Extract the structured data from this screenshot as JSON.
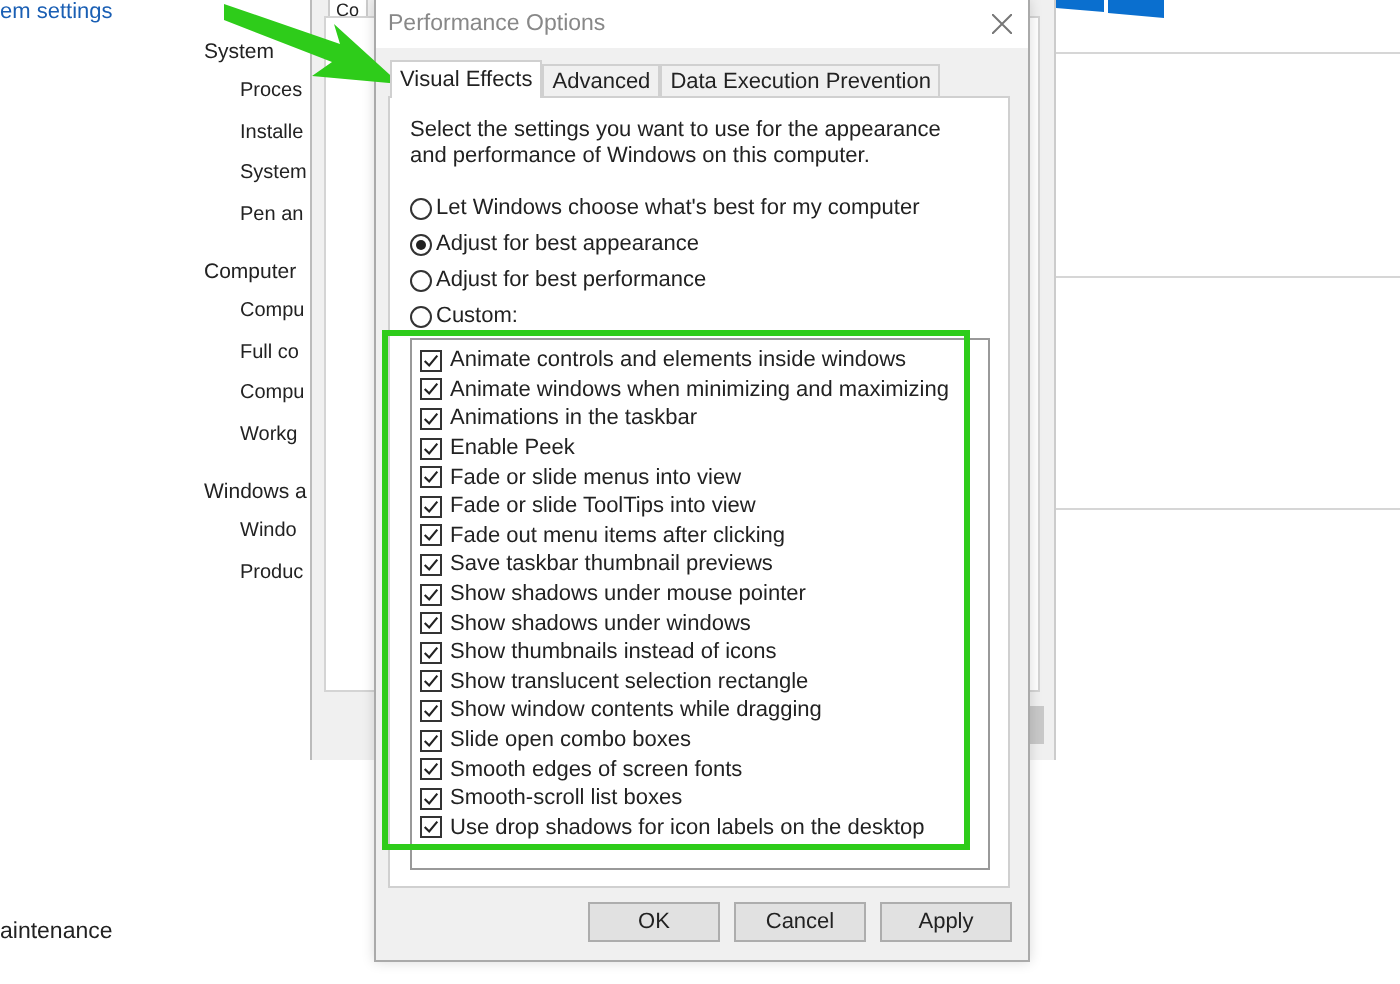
{
  "background_page": {
    "header": "em settings",
    "sections": [
      {
        "title": "System",
        "items": [
          "Proces",
          "Installe",
          "System",
          "Pen an"
        ]
      },
      {
        "title": "Computer",
        "items": [
          "Compu",
          "Full co",
          "Compu",
          "Workg"
        ]
      },
      {
        "title": "Windows a",
        "items": [
          "Windo",
          "Produc"
        ]
      }
    ],
    "footer_link": "aintenance"
  },
  "back_window": {
    "tab": "Co"
  },
  "dialog": {
    "title": "Performance Options",
    "tabs": [
      {
        "label": "Visual Effects",
        "selected": true
      },
      {
        "label": "Advanced",
        "selected": false
      },
      {
        "label": "Data Execution Prevention",
        "selected": false
      }
    ],
    "description": "Select the settings you want to use for the appearance and performance of Windows on this computer.",
    "radio_options": [
      {
        "label": "Let Windows choose what's best for my computer",
        "selected": false
      },
      {
        "label": "Adjust for best appearance",
        "selected": true
      },
      {
        "label": "Adjust for best performance",
        "selected": false
      },
      {
        "label": "Custom:",
        "selected": false
      }
    ],
    "effects": [
      {
        "label": "Animate controls and elements inside windows",
        "checked": true
      },
      {
        "label": "Animate windows when minimizing and maximizing",
        "checked": true
      },
      {
        "label": "Animations in the taskbar",
        "checked": true
      },
      {
        "label": "Enable Peek",
        "checked": true
      },
      {
        "label": "Fade or slide menus into view",
        "checked": true
      },
      {
        "label": "Fade or slide ToolTips into view",
        "checked": true
      },
      {
        "label": "Fade out menu items after clicking",
        "checked": true
      },
      {
        "label": "Save taskbar thumbnail previews",
        "checked": true
      },
      {
        "label": "Show shadows under mouse pointer",
        "checked": true
      },
      {
        "label": "Show shadows under windows",
        "checked": true
      },
      {
        "label": "Show thumbnails instead of icons",
        "checked": true
      },
      {
        "label": "Show translucent selection rectangle",
        "checked": true
      },
      {
        "label": "Show window contents while dragging",
        "checked": true
      },
      {
        "label": "Slide open combo boxes",
        "checked": true
      },
      {
        "label": "Smooth edges of screen fonts",
        "checked": true
      },
      {
        "label": "Smooth-scroll list boxes",
        "checked": true
      },
      {
        "label": "Use drop shadows for icon labels on the desktop",
        "checked": true
      }
    ],
    "buttons": [
      "OK",
      "Cancel",
      "Apply"
    ]
  }
}
